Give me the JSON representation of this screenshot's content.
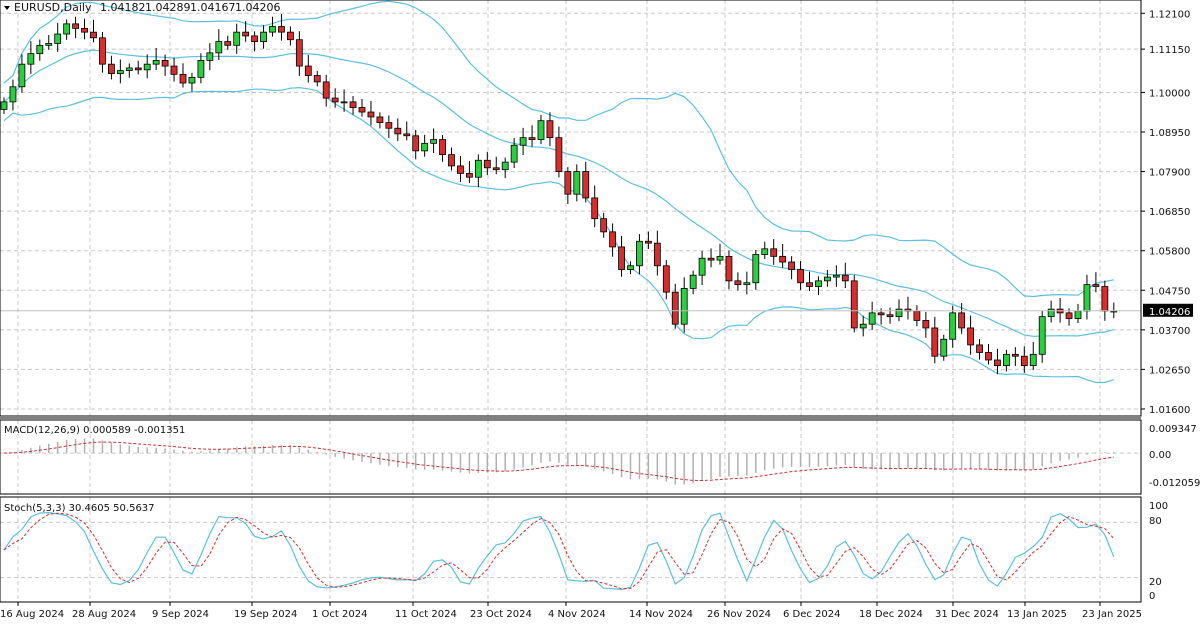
{
  "header": {
    "symbol": "EURUSD,Daily",
    "open": "1.04182",
    "high": "1.04289",
    "low": "1.04167",
    "close": "1.04206"
  },
  "price_labels": [
    "1.12100",
    "1.11150",
    "1.10000",
    "1.08950",
    "1.07900",
    "1.06850",
    "1.05800",
    "1.04750",
    "1.03700",
    "1.02650",
    "1.01600"
  ],
  "current_price": "1.04206",
  "macd": {
    "title": "MACD(12,26,9) 0.000589 -0.001351",
    "scale": [
      "0.009347",
      "0.00",
      "-0.012059"
    ]
  },
  "stoch": {
    "title": "Stoch(5,3,3) 30.4605 50.5637",
    "scale": [
      "100",
      "80",
      "20",
      "0"
    ]
  },
  "date_labels": [
    "16 Aug 2024",
    "28 Aug 2024",
    "9 Sep 2024",
    "19 Sep 2024",
    "1 Oct 2024",
    "11 Oct 2024",
    "23 Oct 2024",
    "4 Nov 2024",
    "14 Nov 2024",
    "26 Nov 2024",
    "6 Dec 2024",
    "18 Dec 2024",
    "31 Dec 2024",
    "13 Jan 2025",
    "23 Jan 2025"
  ],
  "colors": {
    "bull": "#2ecc40",
    "bear": "#d32f2f",
    "bands": "#5bc0de",
    "macd_signal": "#d32f2f",
    "macd_hist": "#b0b0b0",
    "stoch_main": "#5bc0de",
    "stoch_signal": "#d32f2f"
  },
  "chart_data": {
    "type": "candlestick",
    "symbol": "EURUSD",
    "timeframe": "Daily",
    "ylim": [
      1.0144,
      1.124
    ],
    "indicators": [
      "Bollinger Bands",
      "MACD(12,26,9)",
      "Stoch(5,3,3)"
    ],
    "closes": [
      1.0975,
      1.1015,
      1.1075,
      1.1103,
      1.1125,
      1.113,
      1.1155,
      1.1182,
      1.117,
      1.116,
      1.1145,
      1.1075,
      1.105,
      1.1058,
      1.1065,
      1.106,
      1.1075,
      1.1085,
      1.107,
      1.1048,
      1.1025,
      1.104,
      1.1085,
      1.1105,
      1.1135,
      1.1125,
      1.116,
      1.115,
      1.1135,
      1.116,
      1.1175,
      1.116,
      1.114,
      1.107,
      1.1045,
      1.1028,
      1.0985,
      1.0975,
      1.0975,
      1.096,
      1.0948,
      1.0935,
      1.092,
      1.0905,
      1.089,
      1.0885,
      1.0845,
      1.0865,
      1.0875,
      1.0835,
      1.0805,
      1.0785,
      1.0775,
      1.082,
      1.08,
      1.0795,
      1.0815,
      1.086,
      1.088,
      1.0875,
      1.0925,
      1.088,
      1.079,
      1.073,
      1.079,
      1.072,
      1.0665,
      1.063,
      1.059,
      1.053,
      1.054,
      1.0605,
      1.06,
      1.054,
      1.047,
      1.0385,
      1.048,
      1.0515,
      1.056,
      1.0555,
      1.0565,
      1.05,
      1.049,
      1.0495,
      1.057,
      1.0585,
      1.0565,
      1.055,
      1.053,
      1.0495,
      1.0485,
      1.05,
      1.051,
      1.0515,
      1.05,
      1.0375,
      1.0385,
      1.0415,
      1.041,
      1.0405,
      1.0425,
      1.042,
      1.0395,
      1.0375,
      1.03,
      1.0345,
      1.0415,
      1.0375,
      1.033,
      1.031,
      1.029,
      1.0275,
      1.0305,
      1.03,
      1.0275,
      1.0305,
      1.0405,
      1.0425,
      1.0415,
      1.04,
      1.042,
      1.049,
      1.0485,
      1.042,
      1.042
    ]
  }
}
